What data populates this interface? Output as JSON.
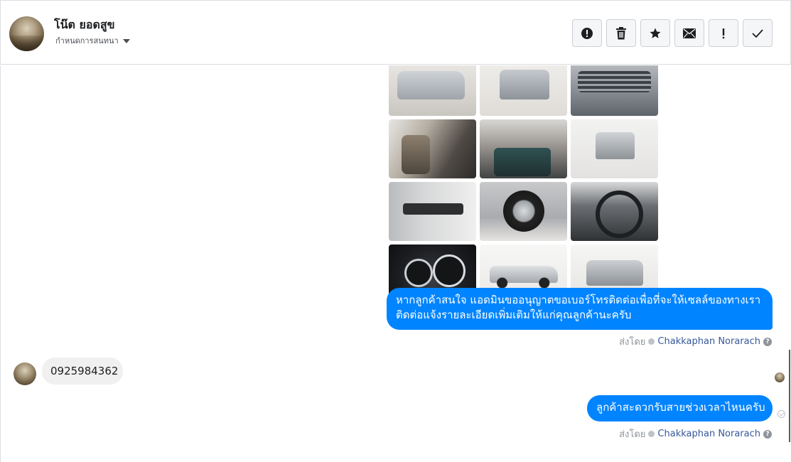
{
  "header": {
    "contact_name": "โน๊ต ยอดสูข",
    "convo_label": "กำหนดการสนทนา"
  },
  "toolbar": {
    "buttons": [
      {
        "name": "report-spam",
        "icon": "alert-circle-icon"
      },
      {
        "name": "delete",
        "icon": "trash-icon"
      },
      {
        "name": "star",
        "icon": "star-icon"
      },
      {
        "name": "mark-unread",
        "icon": "envelope-icon"
      },
      {
        "name": "mark-important",
        "icon": "exclamation-icon"
      },
      {
        "name": "mark-done",
        "icon": "check-icon"
      }
    ]
  },
  "messages": [
    {
      "direction": "out",
      "text": "หากลูกค้าสนใจ แอดมินขออนุญาตขอเบอร์โทรติดต่อเพื่อที่จะให้เซลล์ของทางเรา ติดต่อแจ้งรายละเอียดเพิ่มเติมให้แก่คุณลูกค้านะครับ",
      "sent_by_label": "ส่งโดย",
      "sender": "Chakkaphan Norarach"
    },
    {
      "direction": "in",
      "text": "0925984362"
    },
    {
      "direction": "out",
      "text": "ลูกค้าสะดวกรับสายช่วงเวลาไหนครับ",
      "sent_by_label": "ส่งโดย",
      "sender": "Chakkaphan Norarach"
    }
  ],
  "colors": {
    "outgoing_bubble": "#0084ff",
    "incoming_bubble": "#f1f0f0",
    "sender_link": "#365899"
  }
}
